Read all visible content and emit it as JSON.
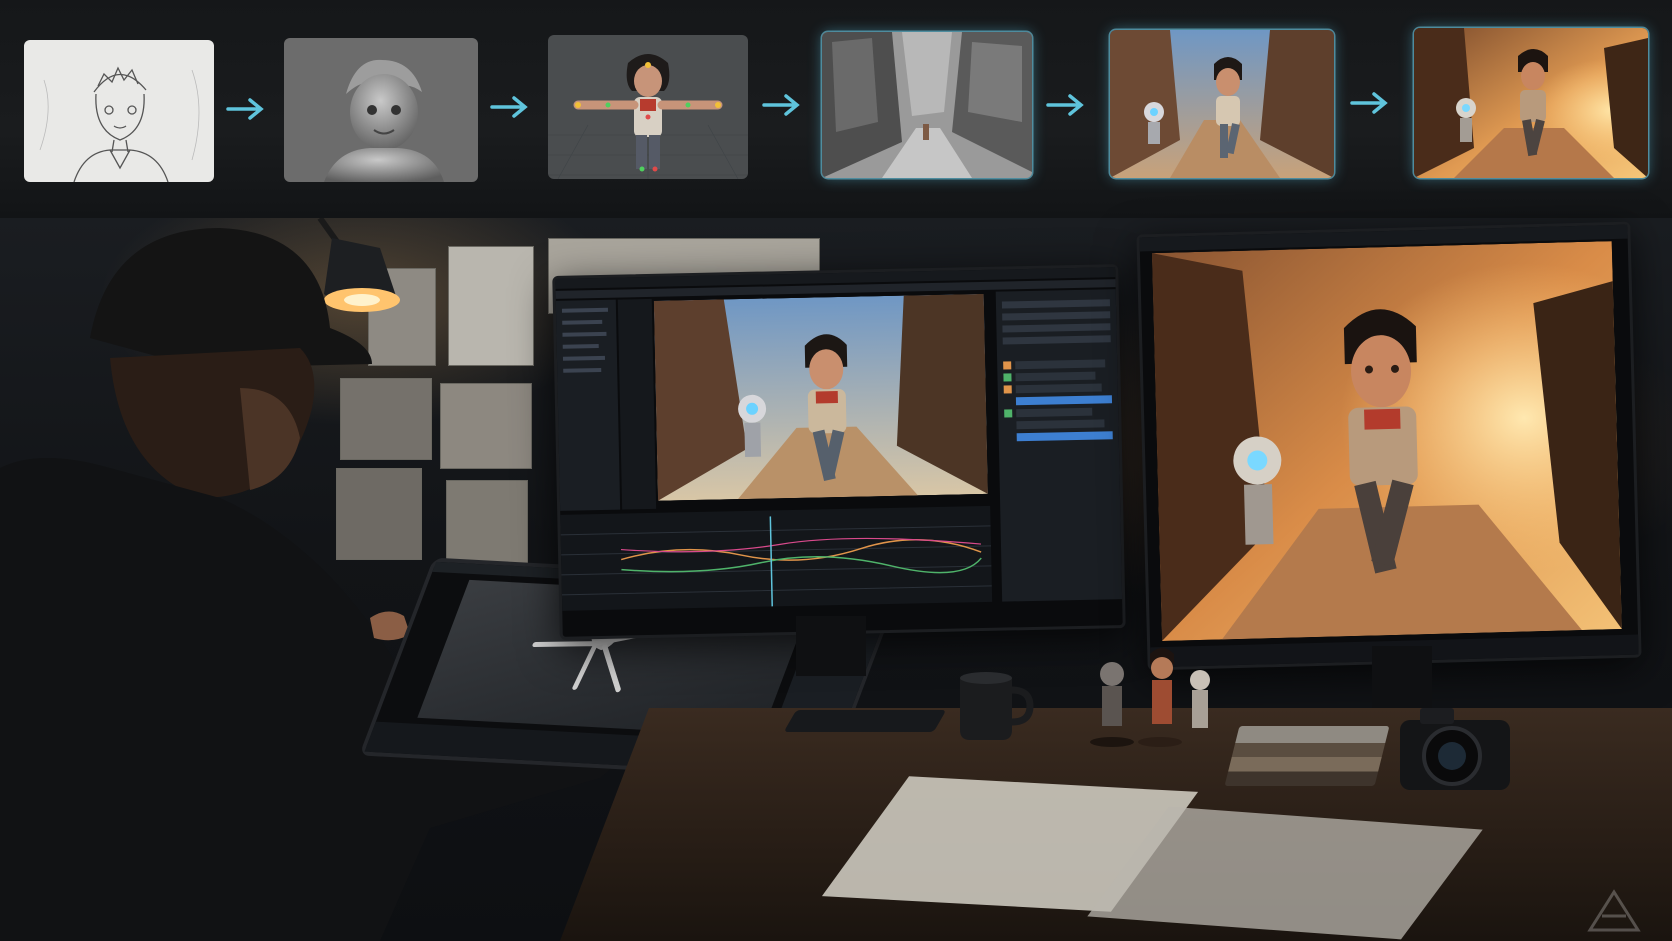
{
  "pipeline": {
    "stages": [
      {
        "icon": "pencil-sketch-stage"
      },
      {
        "icon": "clay-sculpt-stage"
      },
      {
        "icon": "rigging-stage"
      },
      {
        "icon": "layout-blockout-stage"
      },
      {
        "icon": "animation-stage"
      },
      {
        "icon": "final-render-stage"
      }
    ],
    "arrow_color": "#5fc4dc"
  },
  "scene": {
    "icons": {
      "lamp": "desk-lamp-icon",
      "mug": "coffee-mug-icon",
      "camera": "camera-icon",
      "figurines": "figurines-icon",
      "logo": "watermark-logo-icon"
    },
    "colors": {
      "lamp_glow": "#ffc46e",
      "sky_blue": "#6f97c4",
      "sunset": "#e0944a"
    }
  }
}
